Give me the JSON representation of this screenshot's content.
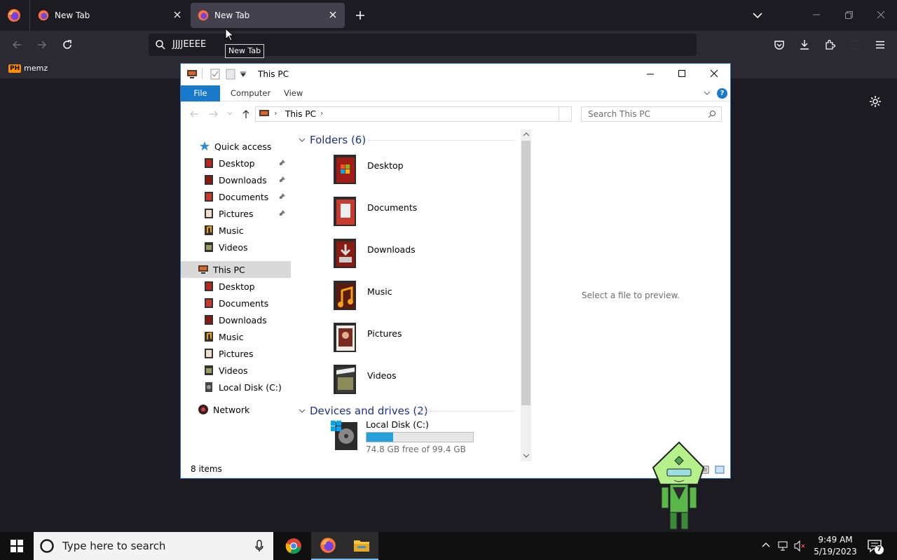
{
  "browser": {
    "tabs": [
      {
        "title": "New Tab"
      },
      {
        "title": "New Tab"
      }
    ],
    "address": "JJJJEEEE",
    "tooltip": "New Tab",
    "bookmarks": [
      {
        "badge": "PH",
        "label": "memz"
      }
    ]
  },
  "explorer": {
    "title": "This PC",
    "ribbon_tabs": [
      "File",
      "Computer",
      "View"
    ],
    "breadcrumb": "This PC",
    "search_placeholder": "Search This PC",
    "nav": {
      "quick_access": {
        "label": "Quick access",
        "items": [
          {
            "label": "Desktop",
            "pinned": true
          },
          {
            "label": "Downloads",
            "pinned": true
          },
          {
            "label": "Documents",
            "pinned": true
          },
          {
            "label": "Pictures",
            "pinned": true
          },
          {
            "label": "Music",
            "pinned": false
          },
          {
            "label": "Videos",
            "pinned": false
          }
        ]
      },
      "this_pc": {
        "label": "This PC",
        "items": [
          {
            "label": "Desktop"
          },
          {
            "label": "Documents"
          },
          {
            "label": "Downloads"
          },
          {
            "label": "Music"
          },
          {
            "label": "Pictures"
          },
          {
            "label": "Videos"
          },
          {
            "label": "Local Disk (C:)"
          }
        ]
      },
      "network": {
        "label": "Network"
      }
    },
    "folders_header": "Folders (6)",
    "folders": [
      "Desktop",
      "Documents",
      "Downloads",
      "Music",
      "Pictures",
      "Videos"
    ],
    "drives_header": "Devices and drives (2)",
    "drive": {
      "name": "Local Disk (C:)",
      "free_text": "74.8 GB free of 99.4 GB",
      "used_fraction": 0.25
    },
    "preview_text": "Select a file to preview.",
    "status": "8 items"
  },
  "taskbar": {
    "search_placeholder": "Type here to search",
    "time": "9:49 AM",
    "date": "5/19/2023",
    "notification_count": "7"
  },
  "colors": {
    "accent": "#1979ca",
    "browser_bg": "#1c1b22",
    "group_header": "#1e3287",
    "drive_bar": "#26a0da"
  }
}
